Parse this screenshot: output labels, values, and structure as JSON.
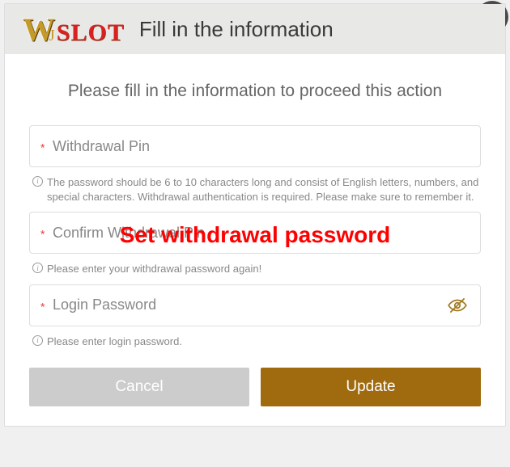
{
  "logo": {
    "slot_text": "SLOT"
  },
  "header": {
    "title": "Fill in the information"
  },
  "subtitle": "Please fill in the information to proceed this action",
  "fields": {
    "withdrawal_pin": {
      "placeholder": "Withdrawal Pin",
      "hint": "The password should be 6 to 10 characters long and consist of English letters, numbers, and special characters. Withdrawal authentication is required. Please make sure to remember it."
    },
    "confirm_withdrawal_pin": {
      "placeholder": "Confirm Withdrawal Pin",
      "hint": "Please enter your withdrawal password again!"
    },
    "login_password": {
      "placeholder": "Login Password",
      "hint": "Please enter login password."
    }
  },
  "overlay": "Set withdrawal password",
  "buttons": {
    "cancel": "Cancel",
    "update": "Update"
  }
}
